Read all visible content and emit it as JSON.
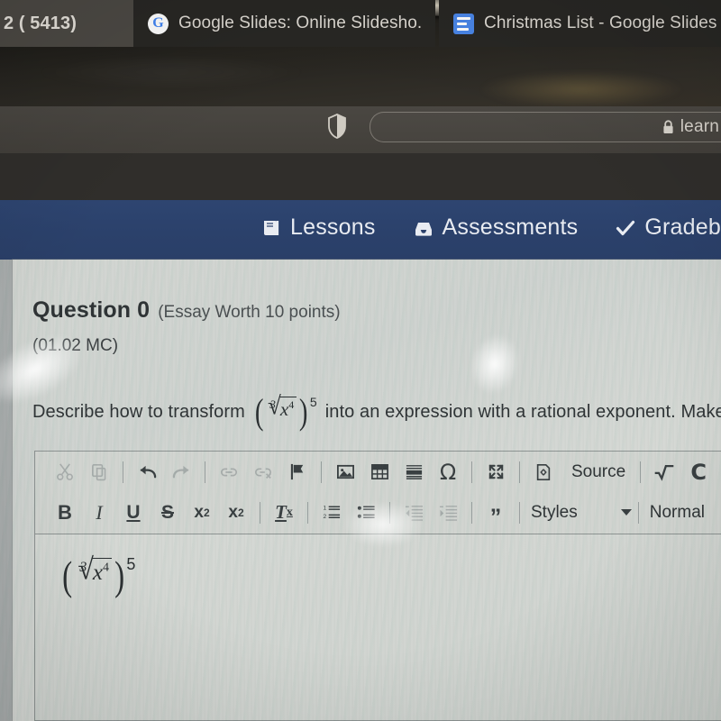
{
  "browser": {
    "shield_icon": "shield-icon",
    "address_bar": {
      "value": "",
      "placeholder": "",
      "lock_icon": "lock-icon",
      "url_text": "learn"
    },
    "tabs": [
      {
        "title": "2 ( 5413)",
        "favicon": "none",
        "active": true
      },
      {
        "title": "Google Slides: Online Slidesho...",
        "favicon": "google-icon",
        "active": false
      },
      {
        "title": "Christmas List - Google Slides ·",
        "favicon": "google-slides-icon",
        "active": false
      }
    ]
  },
  "sitenav": {
    "background_color": "#2b416b",
    "items": [
      {
        "label": "Lessons",
        "icon": "book-icon"
      },
      {
        "label": "Assessments",
        "icon": "inbox-icon"
      },
      {
        "label": "Gradebook",
        "icon": "check-icon"
      }
    ]
  },
  "question": {
    "title": "Question 0",
    "points": "(Essay Worth 10 points)",
    "code": "(01.02 MC)",
    "prompt_before": "Describe how to transform",
    "prompt_after": "into an expression with a rational exponent. Make su",
    "math": {
      "open_paren": "(",
      "radical_index": "3",
      "radical_sign": "√",
      "radicand_base": "x",
      "radicand_exponent": "4",
      "close_paren": ")",
      "outer_exponent": "5"
    }
  },
  "editor": {
    "toolbar_row_1": [
      {
        "name": "cut-icon",
        "label": "",
        "disabled": true
      },
      {
        "name": "copy-icon",
        "label": "",
        "disabled": true
      },
      {
        "name": "separator",
        "label": ""
      },
      {
        "name": "undo-icon",
        "label": "",
        "disabled": false
      },
      {
        "name": "redo-icon",
        "label": "",
        "disabled": true
      },
      {
        "name": "separator",
        "label": ""
      },
      {
        "name": "link-icon",
        "label": "",
        "disabled": true
      },
      {
        "name": "unlink-icon",
        "label": "",
        "disabled": true
      },
      {
        "name": "anchor-flag-icon",
        "label": "",
        "disabled": false
      },
      {
        "name": "separator",
        "label": ""
      },
      {
        "name": "image-icon",
        "label": "",
        "disabled": false
      },
      {
        "name": "table-icon",
        "label": "",
        "disabled": false
      },
      {
        "name": "horizontal-rule-icon",
        "label": "",
        "disabled": false
      },
      {
        "name": "special-character-icon",
        "label": "Ω",
        "disabled": false
      },
      {
        "name": "separator",
        "label": ""
      },
      {
        "name": "maximize-icon",
        "label": "",
        "disabled": false
      },
      {
        "name": "separator",
        "label": ""
      },
      {
        "name": "source-icon",
        "label": "Source",
        "disabled": false
      },
      {
        "name": "separator",
        "label": ""
      },
      {
        "name": "square-root-icon",
        "label": "",
        "disabled": false
      },
      {
        "name": "chemistry-icon",
        "label": "C",
        "disabled": false
      }
    ],
    "toolbar_row_2": [
      {
        "name": "bold-button",
        "label": "B"
      },
      {
        "name": "italic-button",
        "label": "I"
      },
      {
        "name": "underline-button",
        "label": "U"
      },
      {
        "name": "strikethrough-button",
        "label": "S"
      },
      {
        "name": "subscript-button",
        "label": "x2"
      },
      {
        "name": "superscript-button",
        "label": "x2"
      },
      {
        "name": "separator",
        "label": ""
      },
      {
        "name": "remove-format-button",
        "label": "Tx"
      },
      {
        "name": "separator",
        "label": ""
      },
      {
        "name": "numbered-list-button",
        "label": ""
      },
      {
        "name": "bulleted-list-button",
        "label": ""
      },
      {
        "name": "separator",
        "label": ""
      },
      {
        "name": "outdent-button",
        "label": ""
      },
      {
        "name": "indent-button",
        "label": ""
      },
      {
        "name": "separator",
        "label": ""
      },
      {
        "name": "blockquote-button",
        "label": "”"
      },
      {
        "name": "separator",
        "label": ""
      },
      {
        "name": "styles-dropdown",
        "label": "Styles"
      },
      {
        "name": "separator",
        "label": ""
      },
      {
        "name": "format-dropdown",
        "label": "Normal"
      }
    ],
    "styles_label": "Styles",
    "format_label": "Normal",
    "source_label": "Source",
    "omega_label": "Ω",
    "chemistry_label": "C",
    "blockquote_label": "”",
    "bold_label": "B",
    "italic_label": "I",
    "underline_label": "U",
    "strike_label": "S",
    "body": {
      "open_paren": "(",
      "radical_index": "3",
      "radical_sign": "√",
      "radicand_base": "x",
      "radicand_exponent": "4",
      "close_paren": ")",
      "outer_exponent": "5"
    }
  }
}
